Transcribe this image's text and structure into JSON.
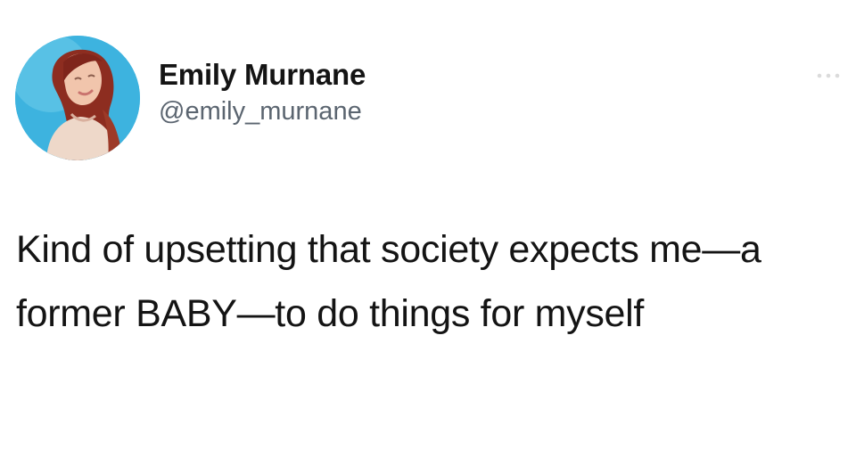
{
  "tweet": {
    "author": {
      "display_name": "Emily Murnane",
      "handle": "@emily_murnane",
      "avatar_icon": "profile-photo"
    },
    "text": "Kind of upsetting that society expects me—a former BABY—to do things for myself",
    "menu_icon": "more-options-icon"
  },
  "colors": {
    "background": "#ffffff",
    "name_text": "#141414",
    "handle_text": "#5b6570",
    "avatar_background": "#3db3df"
  }
}
